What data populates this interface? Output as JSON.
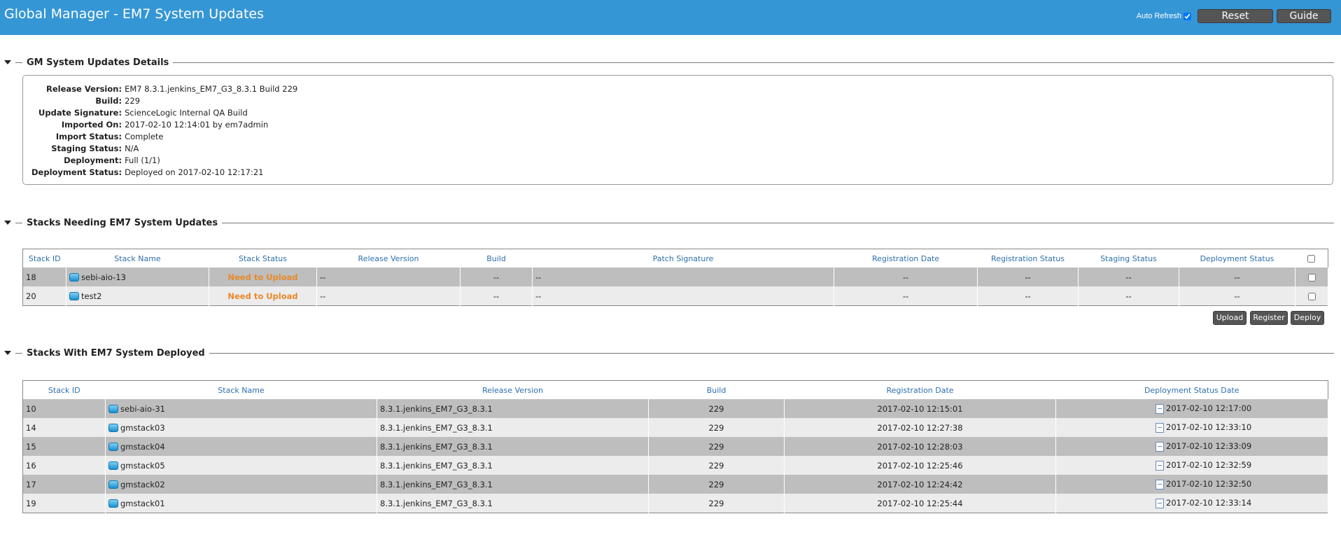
{
  "header": {
    "title": "Global Manager - EM7 System Updates",
    "auto_refresh_label": "Auto Refresh",
    "reset_label": "Reset",
    "guide_label": "Guide"
  },
  "details_section": {
    "title": "GM System Updates Details",
    "fields": [
      {
        "label": "Release Version:",
        "value": "EM7 8.3.1.jenkins_EM7_G3_8.3.1 Build 229"
      },
      {
        "label": "Build:",
        "value": "229"
      },
      {
        "label": "Update Signature:",
        "value": "ScienceLogic Internal QA Build"
      },
      {
        "label": "Imported On:",
        "value": "2017-02-10 12:14:01 by em7admin"
      },
      {
        "label": "Import Status:",
        "value": "Complete"
      },
      {
        "label": "Staging Status:",
        "value": "N/A"
      },
      {
        "label": "Deployment:",
        "value": "Full (1/1)"
      },
      {
        "label": "Deployment Status:",
        "value": "Deployed on 2017-02-10 12:17:21"
      }
    ]
  },
  "needing_section": {
    "title": "Stacks Needing EM7 System Updates",
    "columns": [
      "Stack ID",
      "Stack Name",
      "Stack Status",
      "Release Version",
      "Build",
      "Patch Signature",
      "Registration Date",
      "Registration Status",
      "Staging Status",
      "Deployment Status"
    ],
    "rows": [
      {
        "id": "18",
        "name": "sebi-aio-13",
        "status": "Need to Upload",
        "release": "--",
        "build": "--",
        "signature": "--",
        "reg_date": "--",
        "reg_status": "--",
        "staging": "--",
        "deployment": "--"
      },
      {
        "id": "20",
        "name": "test2",
        "status": "Need to Upload",
        "release": "--",
        "build": "--",
        "signature": "--",
        "reg_date": "--",
        "reg_status": "--",
        "staging": "--",
        "deployment": "--"
      }
    ],
    "buttons": {
      "upload": "Upload",
      "register": "Register",
      "deploy": "Deploy"
    }
  },
  "deployed_section": {
    "title": "Stacks With EM7 System Deployed",
    "columns": [
      "Stack ID",
      "Stack Name",
      "Release Version",
      "Build",
      "Registration Date",
      "Deployment Status Date"
    ],
    "rows": [
      {
        "id": "10",
        "name": "sebi-aio-31",
        "release": "8.3.1.jenkins_EM7_G3_8.3.1",
        "build": "229",
        "reg_date": "2017-02-10 12:15:01",
        "deploy_date": "2017-02-10 12:17:00"
      },
      {
        "id": "14",
        "name": "gmstack03",
        "release": "8.3.1.jenkins_EM7_G3_8.3.1",
        "build": "229",
        "reg_date": "2017-02-10 12:27:38",
        "deploy_date": "2017-02-10 12:33:10"
      },
      {
        "id": "15",
        "name": "gmstack04",
        "release": "8.3.1.jenkins_EM7_G3_8.3.1",
        "build": "229",
        "reg_date": "2017-02-10 12:28:03",
        "deploy_date": "2017-02-10 12:33:09"
      },
      {
        "id": "16",
        "name": "gmstack05",
        "release": "8.3.1.jenkins_EM7_G3_8.3.1",
        "build": "229",
        "reg_date": "2017-02-10 12:25:46",
        "deploy_date": "2017-02-10 12:32:59"
      },
      {
        "id": "17",
        "name": "gmstack02",
        "release": "8.3.1.jenkins_EM7_G3_8.3.1",
        "build": "229",
        "reg_date": "2017-02-10 12:24:42",
        "deploy_date": "2017-02-10 12:32:50"
      },
      {
        "id": "19",
        "name": "gmstack01",
        "release": "8.3.1.jenkins_EM7_G3_8.3.1",
        "build": "229",
        "reg_date": "2017-02-10 12:25:44",
        "deploy_date": "2017-02-10 12:33:14"
      }
    ]
  },
  "colors": {
    "header_bg": "#3596d6",
    "status_need_upload": "#e8892b",
    "link_blue": "#2d6fae"
  },
  "icons": {
    "collapse": "triangle-down-icon",
    "stack": "stack-icon",
    "document": "document-icon"
  }
}
